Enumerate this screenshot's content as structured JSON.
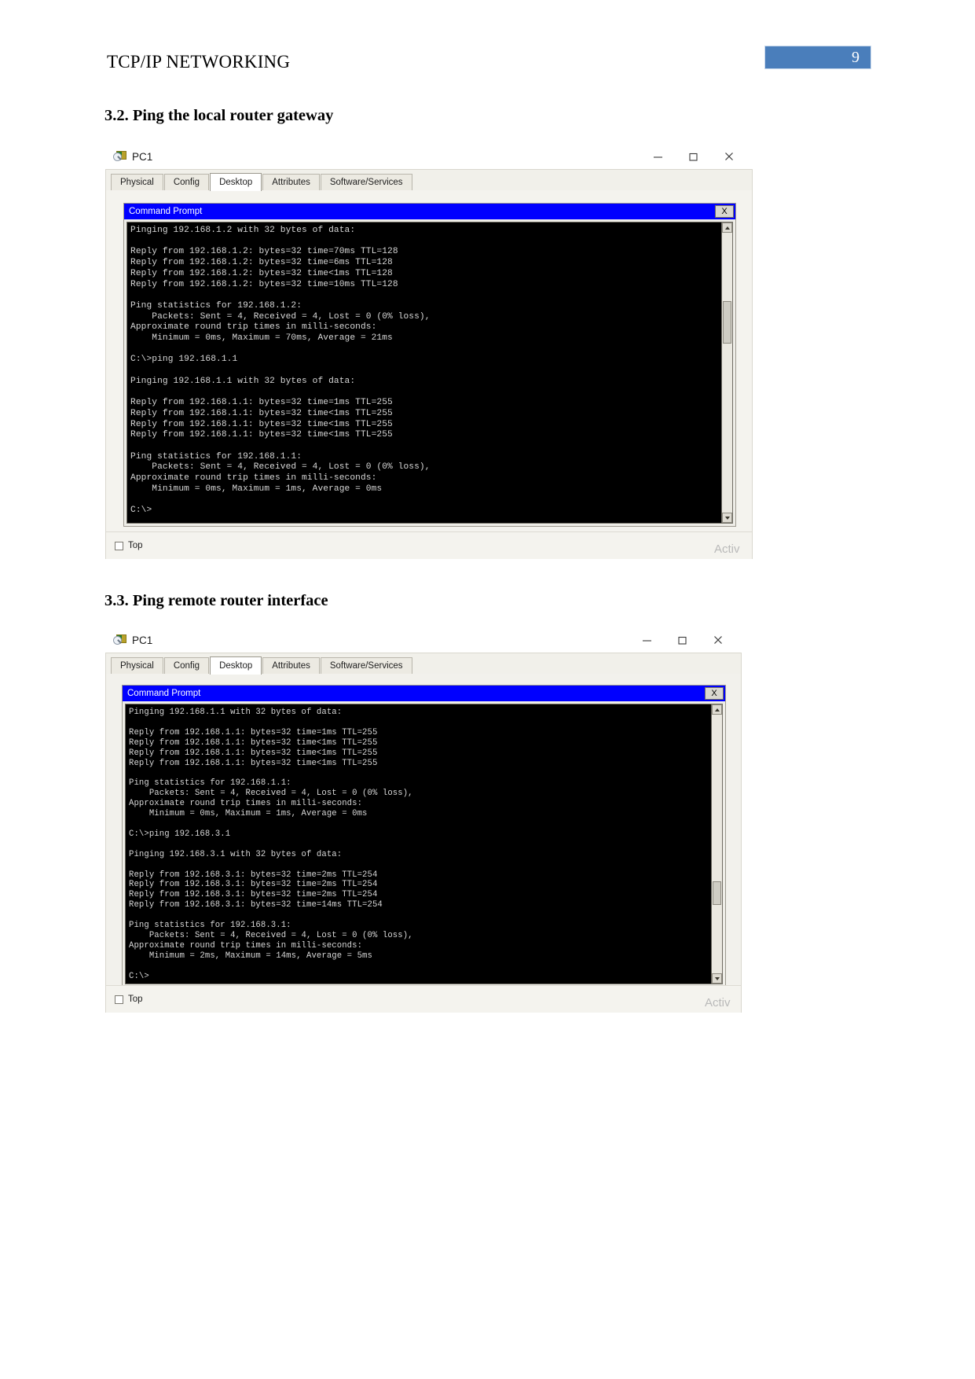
{
  "document": {
    "header_title": "TCP/IP NETWORKING",
    "page_number": "9"
  },
  "sections": [
    {
      "heading": "3.2. Ping the local router gateway"
    },
    {
      "heading": "3.3. Ping remote router interface"
    }
  ],
  "windows": [
    {
      "title": "PC1",
      "minimize_label": "–",
      "maximize_label": "□",
      "close_label": "✕",
      "tabs": [
        {
          "label": "Physical",
          "active": false
        },
        {
          "label": "Config",
          "active": false
        },
        {
          "label": "Desktop",
          "active": true
        },
        {
          "label": "Attributes",
          "active": false
        },
        {
          "label": "Software/Services",
          "active": false
        }
      ],
      "command_prompt": {
        "title": "Command Prompt",
        "close_label": "X",
        "terminal_text": "Pinging 192.168.1.2 with 32 bytes of data:\n\nReply from 192.168.1.2: bytes=32 time=70ms TTL=128\nReply from 192.168.1.2: bytes=32 time=6ms TTL=128\nReply from 192.168.1.2: bytes=32 time<1ms TTL=128\nReply from 192.168.1.2: bytes=32 time=10ms TTL=128\n\nPing statistics for 192.168.1.2:\n    Packets: Sent = 4, Received = 4, Lost = 0 (0% loss),\nApproximate round trip times in milli-seconds:\n    Minimum = 0ms, Maximum = 70ms, Average = 21ms\n\nC:\\>ping 192.168.1.1\n\nPinging 192.168.1.1 with 32 bytes of data:\n\nReply from 192.168.1.1: bytes=32 time=1ms TTL=255\nReply from 192.168.1.1: bytes=32 time<1ms TTL=255\nReply from 192.168.1.1: bytes=32 time<1ms TTL=255\nReply from 192.168.1.1: bytes=32 time<1ms TTL=255\n\nPing statistics for 192.168.1.1:\n    Packets: Sent = 4, Received = 4, Lost = 0 (0% loss),\nApproximate round trip times in milli-seconds:\n    Minimum = 0ms, Maximum = 1ms, Average = 0ms\n\nC:\\>"
      },
      "bottom": {
        "top_checkbox_label": "Top",
        "watermark": "Activ"
      }
    },
    {
      "title": "PC1",
      "minimize_label": "–",
      "maximize_label": "□",
      "close_label": "✕",
      "tabs": [
        {
          "label": "Physical",
          "active": false
        },
        {
          "label": "Config",
          "active": false
        },
        {
          "label": "Desktop",
          "active": true
        },
        {
          "label": "Attributes",
          "active": false
        },
        {
          "label": "Software/Services",
          "active": false
        }
      ],
      "command_prompt": {
        "title": "Command Prompt",
        "close_label": "X",
        "terminal_text": "Pinging 192.168.1.1 with 32 bytes of data:\n\nReply from 192.168.1.1: bytes=32 time=1ms TTL=255\nReply from 192.168.1.1: bytes=32 time<1ms TTL=255\nReply from 192.168.1.1: bytes=32 time<1ms TTL=255\nReply from 192.168.1.1: bytes=32 time<1ms TTL=255\n\nPing statistics for 192.168.1.1:\n    Packets: Sent = 4, Received = 4, Lost = 0 (0% loss),\nApproximate round trip times in milli-seconds:\n    Minimum = 0ms, Maximum = 1ms, Average = 0ms\n\nC:\\>ping 192.168.3.1\n\nPinging 192.168.3.1 with 32 bytes of data:\n\nReply from 192.168.3.1: bytes=32 time=2ms TTL=254\nReply from 192.168.3.1: bytes=32 time=2ms TTL=254\nReply from 192.168.3.1: bytes=32 time=2ms TTL=254\nReply from 192.168.3.1: bytes=32 time=14ms TTL=254\n\nPing statistics for 192.168.3.1:\n    Packets: Sent = 4, Received = 4, Lost = 0 (0% loss),\nApproximate round trip times in milli-seconds:\n    Minimum = 2ms, Maximum = 14ms, Average = 5ms\n\nC:\\>"
      },
      "bottom": {
        "top_checkbox_label": "Top",
        "watermark": "Activ"
      }
    }
  ],
  "colors": {
    "page_badge": "#4a7ebb",
    "cmd_titlebar": "#0000ff",
    "terminal_bg": "#000000",
    "terminal_fg": "#d8d8d8"
  }
}
